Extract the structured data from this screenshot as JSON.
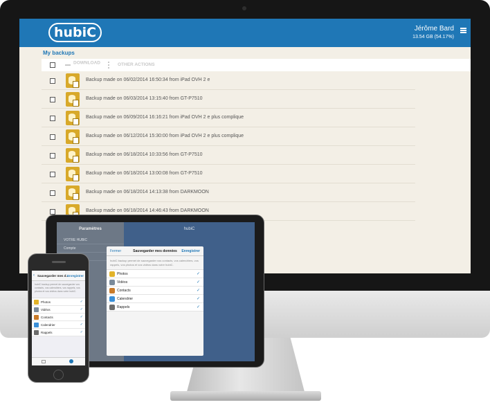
{
  "imac": {
    "app": {
      "logo": "hubiC",
      "user_name": "Jérôme Bard",
      "quota": "13.54 GB (54.17%)",
      "breadcrumb": "My backups",
      "toolbar": {
        "download": "DOWNLOAD",
        "other_actions": "OTHER ACTIONS"
      },
      "backups": [
        "Backup made on 06/02/2014 16:50:34 from iPad OVH 2 e",
        "Backup made on 06/03/2014 13:15:40 from GT-P7510",
        "Backup made on 06/09/2014 16:16:21 from iPad OVH 2 e plus complique",
        "Backup made on 06/12/2014 15:30:00 from iPad OVH 2 e plus complique",
        "Backup made on 06/18/2014 10:33:56 from GT-P7510",
        "Backup made on 06/18/2014 13:00:08 from GT-P7510",
        "Backup made on 06/18/2014 14:13:38 from DARKMOON",
        "Backup made on 06/18/2014 14:46:43 from DARKMOON"
      ]
    }
  },
  "ipad": {
    "left_title": "Paramètres",
    "left_items": [
      "VOTRE HUBIC",
      "Compte",
      "Espace total"
    ],
    "right_title": "hubiC",
    "modal": {
      "cancel": "Fermer",
      "title": "Sauvegarder mes données",
      "save": "Enregistrer",
      "description": "hubiC backup permet de sauvegarder vos contacts, vos calendriers, vos rappels, vos photos et vos vidéos dans votre hubiC.",
      "items": [
        "Photos",
        "Vidéos",
        "Contacts",
        "Calendrier",
        "Rappels"
      ],
      "check": "✓"
    }
  },
  "iphone": {
    "title": "Sauvegarder mes d...",
    "save": "Enregistrer",
    "description": "hubiC backup permet de sauvegarder vos contacts, vos calendriers, vos rappels, vos photos et vos vidéos dans votre hubiC.",
    "items": [
      "Photos",
      "Vidéos",
      "Contacts",
      "Calendrier",
      "Rappels"
    ],
    "check": "✓"
  },
  "colors": {
    "brand": "#1f77b6",
    "backup_icon": "#d8a92a",
    "screen_bg": "#f3efe6"
  },
  "icons": [
    "menu-icon",
    "download-icon",
    "backup-file-icon",
    "photos-icon",
    "videos-icon",
    "contacts-icon",
    "calendar-icon",
    "reminders-icon",
    "back-chevron-icon",
    "checkmark-icon"
  ]
}
